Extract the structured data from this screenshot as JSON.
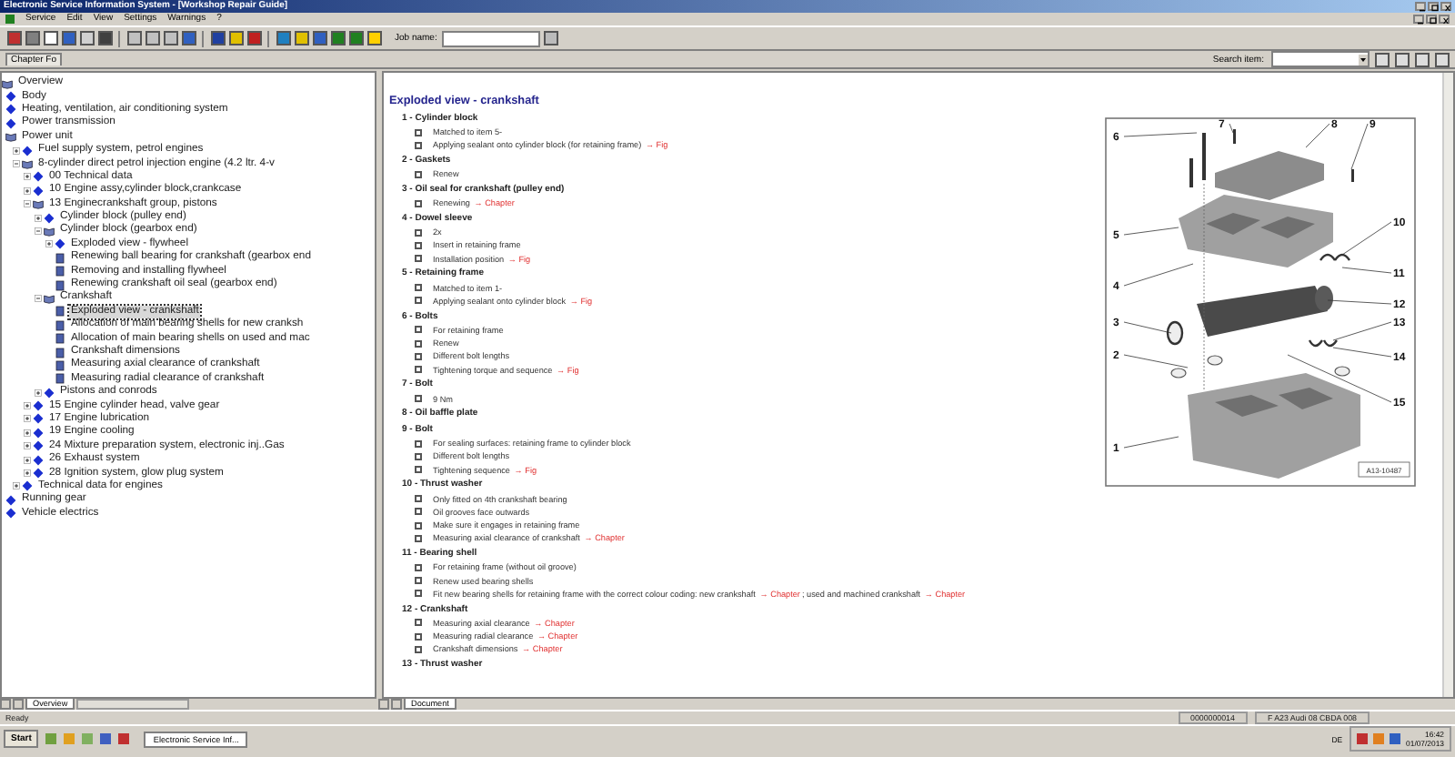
{
  "window": {
    "title": "Electronic Service Information System - [Workshop Repair Guide]"
  },
  "menu": [
    "Service",
    "Edit",
    "View",
    "Settings",
    "Warnings",
    "?"
  ],
  "job": {
    "label": "Job name:"
  },
  "chapter_tab": "Chapter Fo",
  "search": {
    "label": "Search item:"
  },
  "tree": [
    {
      "label": "Overview",
      "kind": "root",
      "selected": false
    },
    {
      "label": "Body",
      "kind": "chapter",
      "expanded": false,
      "selected": false
    },
    {
      "label": "Heating, ventilation, air conditioning system",
      "kind": "chapter",
      "expanded": false,
      "selected": false
    },
    {
      "label": "Power transmission",
      "kind": "chapter",
      "expanded": false,
      "selected": false
    },
    {
      "label": "Power unit",
      "kind": "chapter",
      "expanded": true,
      "selected": false,
      "children": [
        {
          "label": "Fuel supply system, petrol engines",
          "kind": "chapter",
          "expanded": false,
          "selected": false
        },
        {
          "label": "8-cylinder direct petrol injection engine (4.2 ltr. 4-v",
          "kind": "chapter",
          "expanded": true,
          "selected": false,
          "children": [
            {
              "label": "00 Technical data",
              "kind": "chapter",
              "expanded": false,
              "selected": false
            },
            {
              "label": "10 Engine assy,cylinder block,crankcase",
              "kind": "chapter",
              "expanded": false,
              "selected": false
            },
            {
              "label": "13 Enginecrankshaft group, pistons",
              "kind": "chapter",
              "expanded": true,
              "selected": false,
              "children": [
                {
                  "label": "Cylinder block (pulley end)",
                  "kind": "chapter",
                  "expanded": false,
                  "selected": false
                },
                {
                  "label": "Cylinder block (gearbox end)",
                  "kind": "chapter",
                  "expanded": true,
                  "selected": false,
                  "children": [
                    {
                      "label": "Exploded view - flywheel",
                      "kind": "chapter",
                      "expanded": false,
                      "selected": false
                    },
                    {
                      "label": "Renewing ball bearing for crankshaft (gearbox end",
                      "kind": "document",
                      "selected": false
                    },
                    {
                      "label": "Removing and installing flywheel",
                      "kind": "document",
                      "selected": false
                    },
                    {
                      "label": "Renewing crankshaft oil seal (gearbox end)",
                      "kind": "document",
                      "selected": false
                    }
                  ]
                },
                {
                  "label": "Crankshaft",
                  "kind": "chapter",
                  "expanded": true,
                  "selected": false,
                  "children": [
                    {
                      "label": "Exploded view - crankshaft",
                      "kind": "document",
                      "selected": true
                    },
                    {
                      "label": "Allocation of main bearing shells for new cranksh",
                      "kind": "document",
                      "selected": false
                    },
                    {
                      "label": "Allocation of main bearing shells on used and mac",
                      "kind": "document",
                      "selected": false
                    },
                    {
                      "label": "Crankshaft dimensions",
                      "kind": "document",
                      "selected": false
                    },
                    {
                      "label": "Measuring axial clearance of crankshaft",
                      "kind": "document",
                      "selected": false
                    },
                    {
                      "label": "Measuring radial clearance of crankshaft",
                      "kind": "document",
                      "selected": false
                    }
                  ]
                },
                {
                  "label": "Pistons and conrods",
                  "kind": "chapter",
                  "expanded": false,
                  "selected": false
                }
              ]
            },
            {
              "label": "15 Engine cylinder head, valve gear",
              "kind": "chapter",
              "expanded": false,
              "selected": false
            },
            {
              "label": "17 Engine lubrication",
              "kind": "chapter",
              "expanded": false,
              "selected": false
            },
            {
              "label": "19 Engine cooling",
              "kind": "chapter",
              "expanded": false,
              "selected": false
            },
            {
              "label": "24 Mixture preparation system, electronic inj..Gas",
              "kind": "chapter",
              "expanded": false,
              "selected": false
            },
            {
              "label": "26 Exhaust system",
              "kind": "chapter",
              "expanded": false,
              "selected": false
            },
            {
              "label": "28 Ignition system, glow plug system",
              "kind": "chapter",
              "expanded": false,
              "selected": false
            }
          ]
        },
        {
          "label": "Technical data for engines",
          "kind": "chapter",
          "expanded": false,
          "selected": false
        }
      ]
    },
    {
      "label": "Running gear",
      "kind": "chapter",
      "expanded": false,
      "selected": false
    },
    {
      "label": "Vehicle electrics",
      "kind": "chapter",
      "expanded": false,
      "selected": false
    }
  ],
  "document": {
    "title": "Exploded view - crankshaft",
    "items": [
      {
        "title": "1 - Cylinder block",
        "notes": [
          [
            {
              "kind": "text",
              "text": "Matched to item 5-"
            }
          ],
          [
            {
              "kind": "text",
              "text": "Applying sealant onto cylinder block (for retaining frame)"
            },
            {
              "kind": "link",
              "text": "→ Fig"
            }
          ]
        ]
      },
      {
        "title": "2 - Gaskets",
        "notes": [
          [
            {
              "kind": "text",
              "text": "Renew"
            }
          ]
        ]
      },
      {
        "title": "3 - Oil seal for crankshaft (pulley end)",
        "notes": [
          [
            {
              "kind": "text",
              "text": "Renewing"
            },
            {
              "kind": "link",
              "text": "→ Chapter"
            }
          ]
        ]
      },
      {
        "title": "4 - Dowel sleeve",
        "notes": [
          [
            {
              "kind": "text",
              "text": "2x"
            }
          ],
          [
            {
              "kind": "text",
              "text": "Insert in retaining frame"
            }
          ],
          [
            {
              "kind": "text",
              "text": "Installation position"
            },
            {
              "kind": "link",
              "text": "→ Fig"
            }
          ]
        ]
      },
      {
        "title": "5 - Retaining frame",
        "notes": [
          [
            {
              "kind": "text",
              "text": "Matched to item 1-"
            }
          ],
          [
            {
              "kind": "text",
              "text": "Applying sealant onto cylinder block"
            },
            {
              "kind": "link",
              "text": "→ Fig"
            }
          ]
        ]
      },
      {
        "title": "6 - Bolts",
        "notes": [
          [
            {
              "kind": "text",
              "text": "For retaining frame"
            }
          ],
          [
            {
              "kind": "text",
              "text": "Renew"
            }
          ],
          [
            {
              "kind": "text",
              "text": "Different bolt lengths"
            }
          ],
          [
            {
              "kind": "text",
              "text": "Tightening torque and sequence"
            },
            {
              "kind": "link",
              "text": "→ Fig"
            }
          ]
        ]
      },
      {
        "title": "7 - Bolt",
        "notes": [
          [
            {
              "kind": "text",
              "text": "9 Nm"
            }
          ]
        ]
      },
      {
        "title": "8 - Oil baffle plate"
      },
      {
        "title": "9 - Bolt",
        "notes": [
          [
            {
              "kind": "text",
              "text": "For sealing surfaces: retaining frame to cylinder block"
            }
          ],
          [
            {
              "kind": "text",
              "text": "Different bolt lengths"
            }
          ],
          [
            {
              "kind": "text",
              "text": "Tightening sequence"
            },
            {
              "kind": "link",
              "text": "→ Fig"
            }
          ]
        ]
      },
      {
        "title": "10 - Thrust washer",
        "notes": [
          [
            {
              "kind": "text",
              "text": "Only fitted on 4th crankshaft bearing"
            }
          ],
          [
            {
              "kind": "text",
              "text": "Oil grooves face outwards"
            }
          ],
          [
            {
              "kind": "text",
              "text": "Make sure it engages in retaining frame"
            }
          ],
          [
            {
              "kind": "text",
              "text": "Measuring axial clearance of crankshaft"
            },
            {
              "kind": "link",
              "text": "→ Chapter"
            }
          ]
        ]
      },
      {
        "title": "11 - Bearing shell",
        "notes": [
          [
            {
              "kind": "text",
              "text": "For retaining frame (without oil groove)"
            }
          ],
          [
            {
              "kind": "text",
              "text": "Renew used bearing shells"
            }
          ],
          [
            {
              "kind": "text",
              "text": "Fit new bearing shells for retaining frame with the correct colour coding: new crankshaft"
            },
            {
              "kind": "link",
              "text": "→ Chapter"
            },
            {
              "kind": "text",
              "text": "; used and machined crankshaft"
            },
            {
              "kind": "link",
              "text": "→ Chapter"
            }
          ]
        ]
      },
      {
        "title": "12 - Crankshaft",
        "notes": [
          [
            {
              "kind": "text",
              "text": "Measuring axial clearance"
            },
            {
              "kind": "link",
              "text": "→ Chapter"
            }
          ],
          [
            {
              "kind": "text",
              "text": "Measuring radial clearance"
            },
            {
              "kind": "link",
              "text": "→ Chapter"
            }
          ],
          [
            {
              "kind": "text",
              "text": "Crankshaft dimensions"
            },
            {
              "kind": "link",
              "text": "→ Chapter"
            }
          ]
        ]
      },
      {
        "title": "13 - Thrust washer"
      }
    ]
  },
  "diagram": {
    "callouts": [
      "7",
      "8",
      "9",
      "6",
      "10",
      "5",
      "11",
      "4",
      "12",
      "3",
      "13",
      "2",
      "14",
      "15",
      "1"
    ],
    "code": "A13-10487"
  },
  "left_tab": "Overview",
  "right_tab": "Document",
  "status": {
    "ready": "Ready",
    "counter": "0000000014",
    "vehicle": "F A23 Audi 08 CBDA 008"
  },
  "taskbar": {
    "start": "Start",
    "task": "Electronic Service Inf...",
    "language": "DE",
    "time": "16:42",
    "date": "01/07/2013"
  }
}
